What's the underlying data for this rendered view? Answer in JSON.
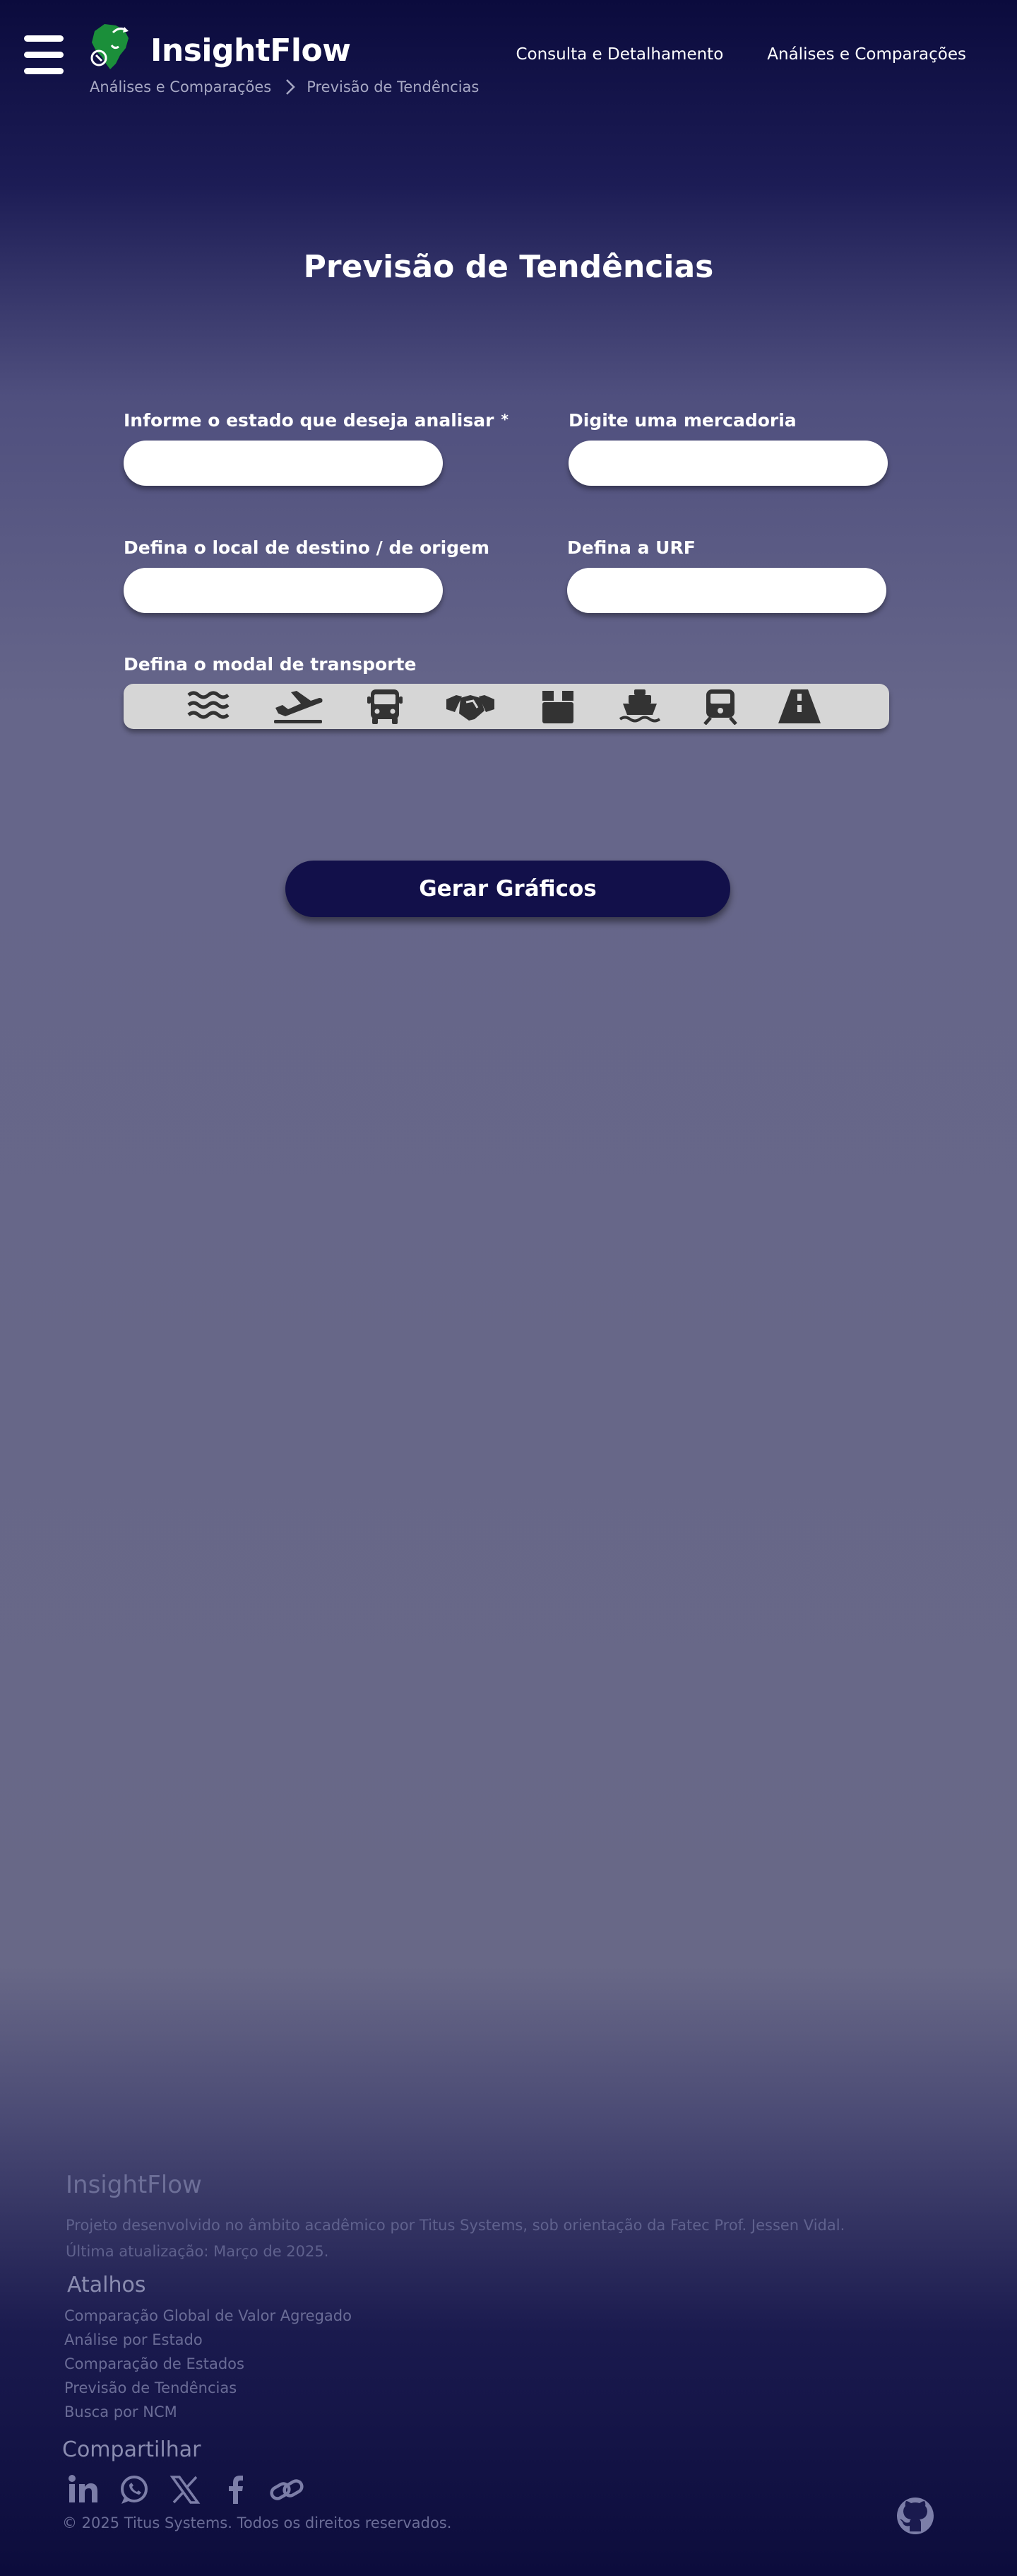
{
  "header": {
    "brand": "InsightFlow",
    "breadcrumb": [
      "Análises e Comparações",
      "Previsão de Tendências"
    ],
    "nav": [
      "Consulta e Detalhamento",
      "Análises e Comparações"
    ]
  },
  "page": {
    "title": "Previsão de Tendências"
  },
  "form": {
    "state_label": "Informe o estado que deseja analisar",
    "state_required_mark": "*",
    "state_value": "",
    "product_label": "Digite uma mercadoria",
    "product_value": "",
    "destination_label": "Defina o local de destino / de origem",
    "destination_value": "",
    "urf_label": "Defina a URF",
    "urf_value": "",
    "modal_label": "Defina o modal de transporte",
    "modal_options": [
      "waves-icon",
      "airplane-icon",
      "bus-icon",
      "handshake-icon",
      "package-icon",
      "ship-icon",
      "train-icon",
      "road-icon"
    ],
    "submit_label": "Gerar Gráficos"
  },
  "footer": {
    "title": "InsightFlow",
    "description": "Projeto desenvolvido no âmbito acadêmico por Titus Systems, sob orientação da Fatec Prof. Jessen Vidal.",
    "updated": "Última atualização: Março de 2025.",
    "shortcuts_heading": "Atalhos",
    "shortcuts": [
      "Comparação Global de Valor Agregado",
      "Análise por Estado",
      "Comparação de Estados",
      "Previsão de Tendências",
      "Busca por NCM"
    ],
    "share_heading": "Compartilhar",
    "share_icons": [
      "linkedin-icon",
      "whatsapp-icon",
      "x-icon",
      "facebook-icon",
      "link-icon"
    ],
    "copyright": "© 2025 Titus Systems. Todos os direitos reservados."
  },
  "colors": {
    "accent_button": "#12104a",
    "logo_green": "#1b8f3a",
    "modal_bar": "#d6d6d6",
    "icon_dark": "#333333"
  }
}
